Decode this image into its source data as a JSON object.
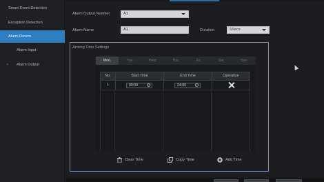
{
  "sidebar": {
    "items": [
      {
        "label": "Smart Event Detection"
      },
      {
        "label": "Exception Detection"
      },
      {
        "label": "Alarm Device"
      },
      {
        "label": "Alarm Input"
      },
      {
        "label": "Alarm Output"
      }
    ]
  },
  "form": {
    "output_number_label": "Alarm Output Number",
    "output_number_value": "A1",
    "alarm_name_label": "Alarm Name",
    "alarm_name_value": "A1",
    "duration_label": "Duration",
    "duration_value": "5Secs"
  },
  "arming": {
    "title": "Arming Time Settings",
    "days": [
      "Mon.",
      "Tue.",
      "Wed.",
      "Thu.",
      "Fri.",
      "Sat.",
      "Sun."
    ],
    "active_day": "Mon.",
    "columns": [
      "No.",
      "Start Time",
      "End Time",
      "Operation"
    ],
    "rows": [
      {
        "no": "1",
        "start": "00:00",
        "end": "24:00"
      }
    ],
    "actions": {
      "clear": "Clear Time",
      "copy": "Copy Time",
      "add": "Add Time"
    }
  },
  "colors": {
    "accent": "#2d7fc1",
    "box_border": "#7694bd",
    "background": "#1b1d21"
  }
}
